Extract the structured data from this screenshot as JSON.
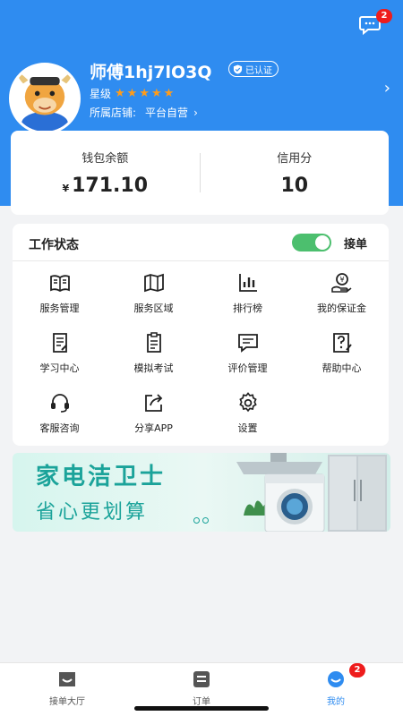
{
  "header": {
    "messages_badge": "2",
    "profile": {
      "name": "师傅1hj7lO3Q",
      "certified_label": "已认证",
      "star_label": "星级",
      "stars": 5,
      "store_label": "所属店铺:",
      "store_name": "平台自营"
    }
  },
  "wallet": {
    "balance_label": "钱包余额",
    "currency": "¥",
    "balance": "171.10",
    "credit_label": "信用分",
    "credit": "10"
  },
  "work": {
    "title": "工作状态",
    "toggle_on": true,
    "toggle_label": "接单",
    "items": [
      {
        "label": "服务管理",
        "icon": "book-icon"
      },
      {
        "label": "服务区域",
        "icon": "map-icon"
      },
      {
        "label": "排行榜",
        "icon": "bar-chart-icon"
      },
      {
        "label": "我的保证金",
        "icon": "deposit-icon"
      },
      {
        "label": "学习中心",
        "icon": "study-icon"
      },
      {
        "label": "模拟考试",
        "icon": "exam-icon"
      },
      {
        "label": "评价管理",
        "icon": "comment-icon"
      },
      {
        "label": "帮助中心",
        "icon": "help-icon"
      },
      {
        "label": "客服咨询",
        "icon": "headset-icon"
      },
      {
        "label": "分享APP",
        "icon": "share-icon"
      },
      {
        "label": "设置",
        "icon": "gear-icon"
      }
    ]
  },
  "banner": {
    "title": "家电洁卫士",
    "subtitle": "省心更划算"
  },
  "nav": {
    "items": [
      {
        "label": "接单大厅",
        "icon": "hall-icon"
      },
      {
        "label": "订单",
        "icon": "order-icon"
      },
      {
        "label": "我的",
        "icon": "profile-icon",
        "badge": "2"
      }
    ],
    "active_index": 2
  },
  "colors": {
    "primary": "#2f8cf0",
    "star": "#ff9c1a",
    "toggle": "#4cbf6e",
    "badge": "#ee1c1c",
    "banner_text": "#1ba39a"
  }
}
